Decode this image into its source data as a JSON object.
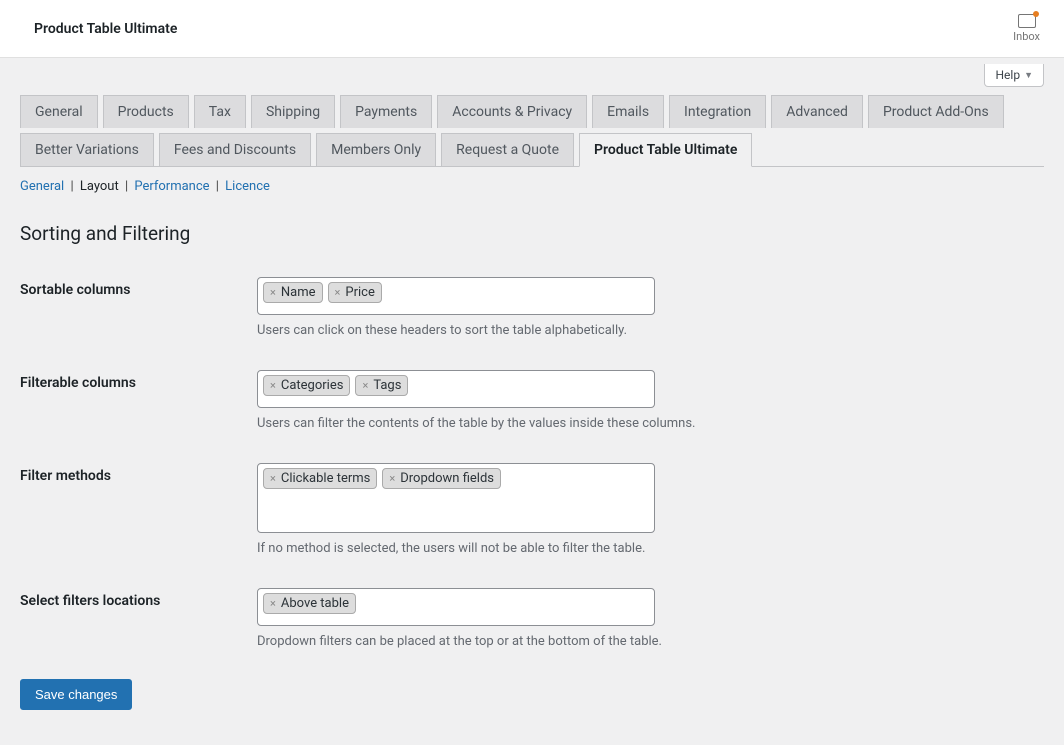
{
  "header": {
    "title": "Product Table Ultimate",
    "inbox_label": "Inbox"
  },
  "help_label": "Help",
  "tabs": [
    "General",
    "Products",
    "Tax",
    "Shipping",
    "Payments",
    "Accounts & Privacy",
    "Emails",
    "Integration",
    "Advanced",
    "Product Add-Ons",
    "Better Variations",
    "Fees and Discounts",
    "Members Only",
    "Request a Quote",
    "Product Table Ultimate"
  ],
  "active_tab": "Product Table Ultimate",
  "subsub": {
    "items": [
      "General",
      "Layout",
      "Performance",
      "Licence"
    ],
    "current": "Layout"
  },
  "section_title": "Sorting and Filtering",
  "fields": {
    "sortable": {
      "label": "Sortable columns",
      "tags": [
        "Name",
        "Price"
      ],
      "description": "Users can click on these headers to sort the table alphabetically."
    },
    "filterable": {
      "label": "Filterable columns",
      "tags": [
        "Categories",
        "Tags"
      ],
      "description": "Users can filter the contents of the table by the values inside these columns."
    },
    "methods": {
      "label": "Filter methods",
      "tags": [
        "Clickable terms",
        "Dropdown fields"
      ],
      "description": "If no method is selected, the users will not be able to filter the table."
    },
    "locations": {
      "label": "Select filters locations",
      "tags": [
        "Above table"
      ],
      "description": "Dropdown filters can be placed at the top or at the bottom of the table."
    }
  },
  "save_label": "Save changes"
}
